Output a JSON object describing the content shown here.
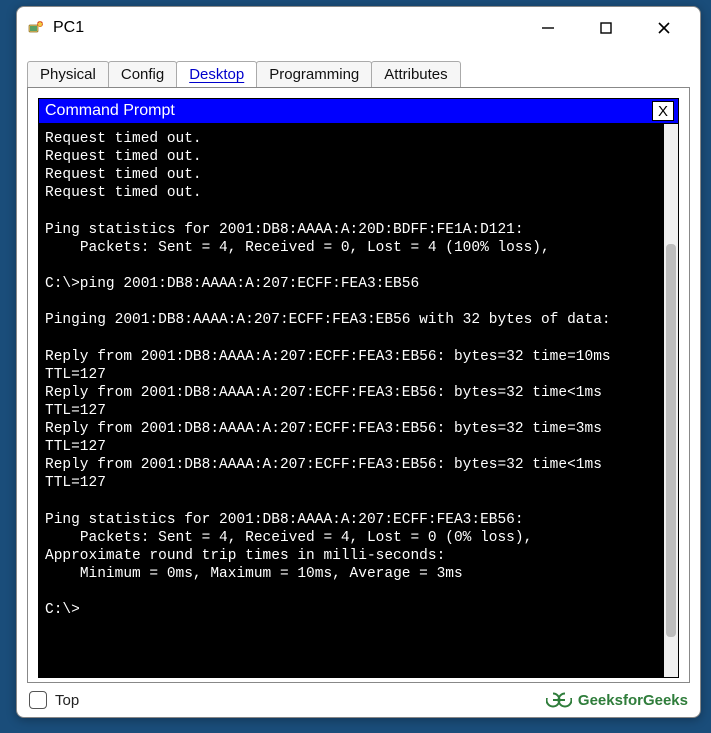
{
  "window": {
    "title": "PC1",
    "controls": {
      "minimize": "−",
      "maximize": "□",
      "close": "✕"
    }
  },
  "tabs": [
    {
      "label": "Physical",
      "active": false
    },
    {
      "label": "Config",
      "active": false
    },
    {
      "label": "Desktop",
      "active": true
    },
    {
      "label": "Programming",
      "active": false
    },
    {
      "label": "Attributes",
      "active": false
    }
  ],
  "panel": {
    "title": "Command Prompt",
    "close_label": "X"
  },
  "console_text": "Request timed out.\nRequest timed out.\nRequest timed out.\nRequest timed out.\n\nPing statistics for 2001:DB8:AAAA:A:20D:BDFF:FE1A:D121:\n    Packets: Sent = 4, Received = 0, Lost = 4 (100% loss),\n\nC:\\>ping 2001:DB8:AAAA:A:207:ECFF:FEA3:EB56\n\nPinging 2001:DB8:AAAA:A:207:ECFF:FEA3:EB56 with 32 bytes of data:\n\nReply from 2001:DB8:AAAA:A:207:ECFF:FEA3:EB56: bytes=32 time=10ms TTL=127\nReply from 2001:DB8:AAAA:A:207:ECFF:FEA3:EB56: bytes=32 time<1ms TTL=127\nReply from 2001:DB8:AAAA:A:207:ECFF:FEA3:EB56: bytes=32 time=3ms TTL=127\nReply from 2001:DB8:AAAA:A:207:ECFF:FEA3:EB56: bytes=32 time<1ms TTL=127\n\nPing statistics for 2001:DB8:AAAA:A:207:ECFF:FEA3:EB56:\n    Packets: Sent = 4, Received = 4, Lost = 0 (0% loss),\nApproximate round trip times in milli-seconds:\n    Minimum = 0ms, Maximum = 10ms, Average = 3ms\n\nC:\\>",
  "footer": {
    "top_label": "Top",
    "watermark": "GeeksforGeeks"
  }
}
